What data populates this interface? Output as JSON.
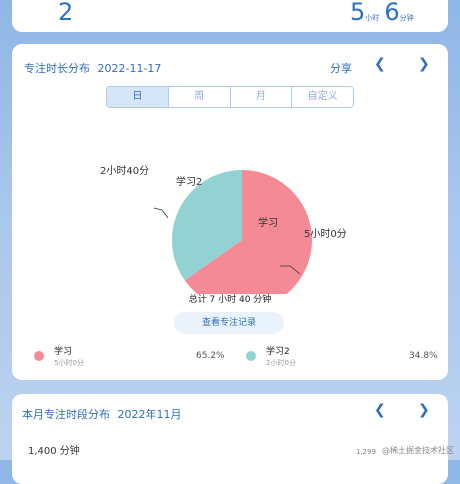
{
  "summary": {
    "left_value": "2",
    "hours": "5",
    "hours_unit": "小时",
    "minutes": "6",
    "minutes_unit": "分钟"
  },
  "distribution": {
    "title": "专注时长分布",
    "date": "2022-11-17",
    "share_label": "分享",
    "prev_icon": "chevron-left-icon",
    "next_icon": "chevron-right-icon",
    "tabs": [
      "日",
      "周",
      "月",
      "自定义"
    ],
    "selected_tab": "日",
    "chart_labels": {
      "study": {
        "name": "学习",
        "duration": "5小时0分"
      },
      "study2": {
        "name": "学习2",
        "duration": "2小时40分"
      }
    },
    "total_text": "总计 7 小时 40 分钟",
    "record_button": "查看专注记录",
    "legend": [
      {
        "name": "学习",
        "sub": "5小时0分",
        "percent": "65.2%",
        "color": "#f58a97"
      },
      {
        "name": "学习2",
        "sub": "2小时0分",
        "percent": "34.8%",
        "color": "#93d2d2"
      }
    ]
  },
  "chart_data": {
    "type": "pie",
    "categories": [
      "学习",
      "学习2"
    ],
    "values": [
      65.2,
      34.8
    ],
    "colors": [
      "#f58a97",
      "#93d2d2"
    ]
  },
  "monthly": {
    "title": "本月专注时段分布",
    "month": "2022年11月",
    "y_top_label": "1,400 分钟",
    "y_right_label": "1,299"
  },
  "watermark": "@稀土掘金技术社区"
}
